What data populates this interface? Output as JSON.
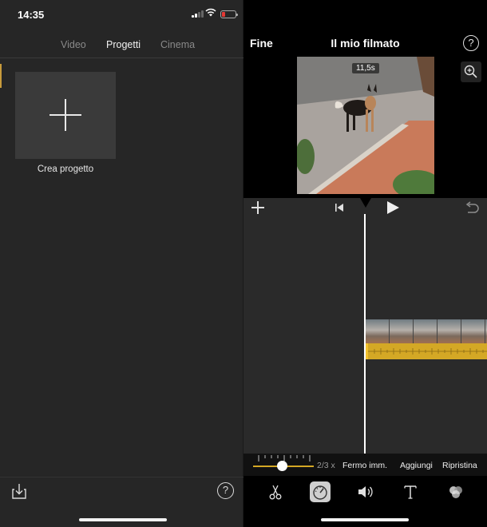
{
  "status_bar": {
    "time": "14:35"
  },
  "left": {
    "tabs": [
      {
        "label": "Video",
        "active": false
      },
      {
        "label": "Progetti",
        "active": true
      },
      {
        "label": "Cinema",
        "active": false
      }
    ],
    "new_project_label": "Crea progetto",
    "footer": {
      "import_icon": "import-icon",
      "help_label": "?"
    }
  },
  "right": {
    "header": {
      "done_label": "Fine",
      "title": "Il mio filmato",
      "help_label": "?"
    },
    "preview": {
      "duration": "11,5s"
    },
    "speed": {
      "value": "2/3 x",
      "actions": [
        "Fermo imm.",
        "Aggiungi",
        "Ripristina"
      ]
    },
    "tools": [
      {
        "name": "scissors-icon"
      },
      {
        "name": "speedometer-icon",
        "selected": true
      },
      {
        "name": "volume-icon"
      },
      {
        "name": "title-icon"
      },
      {
        "name": "filters-icon"
      }
    ]
  },
  "colors": {
    "accent": "#d4a825",
    "battery_low": "#e53935",
    "panel_bg": "#262626"
  }
}
